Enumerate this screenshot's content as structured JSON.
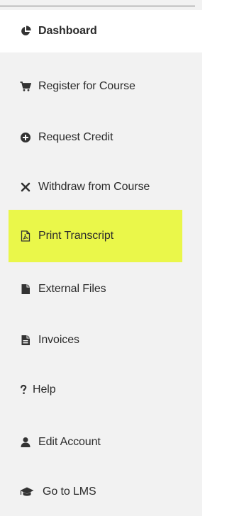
{
  "sidebar": {
    "items": [
      {
        "label": "Dashboard",
        "icon": "pie-chart-icon"
      },
      {
        "label": "Register for Course",
        "icon": "cart-icon"
      },
      {
        "label": "Request Credit",
        "icon": "plus-circle-icon"
      },
      {
        "label": "Withdraw from Course",
        "icon": "close-icon"
      },
      {
        "label": "Print Transcript",
        "icon": "pdf-file-icon"
      },
      {
        "label": "External Files",
        "icon": "file-icon"
      },
      {
        "label": "Invoices",
        "icon": "invoice-icon"
      },
      {
        "label": "Help",
        "icon": "question-icon"
      },
      {
        "label": "Edit Account",
        "icon": "user-icon"
      },
      {
        "label": "Go to LMS",
        "icon": "graduation-cap-icon"
      }
    ]
  },
  "colors": {
    "highlight": "#eaf74a",
    "text": "#2b2b2b",
    "icon": "#333333",
    "sidebar_bg": "#f2f2f2"
  }
}
